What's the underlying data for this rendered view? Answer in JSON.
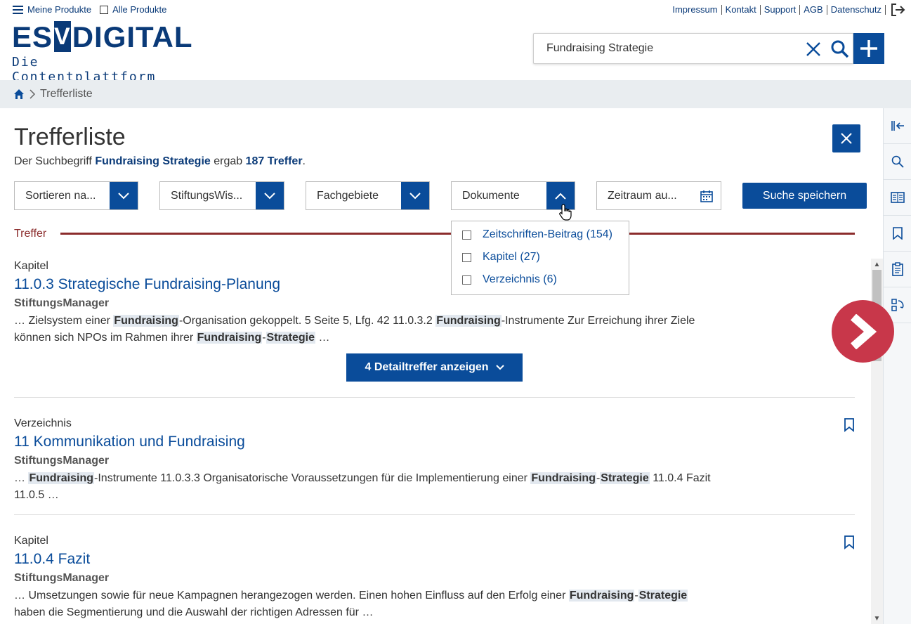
{
  "top_left": {
    "my_products": "Meine Produkte",
    "all_products": "Alle Produkte"
  },
  "top_right": {
    "links": [
      "Impressum",
      "Kontakt",
      "Support",
      "AGB",
      "Datenschutz"
    ]
  },
  "logo": {
    "esv_left": "ES",
    "esv_v": "V",
    "digital": "DIGITAL",
    "subtitle": "Die Contentplattform"
  },
  "search": {
    "value": "Fundraising Strategie"
  },
  "breadcrumb": {
    "current": "Trefferliste"
  },
  "page": {
    "title": "Trefferliste",
    "summary_prefix": "Der Suchbegriff ",
    "summary_term": "Fundraising Strategie",
    "summary_middle": " ergab ",
    "summary_count": "187 Treffer",
    "summary_suffix": "."
  },
  "filters": {
    "sort": "Sortieren na...",
    "product": "StiftungsWis...",
    "subject": "Fachgebiete",
    "documents": "Dokumente",
    "period": "Zeitraum au...",
    "save_search": "Suche speichern"
  },
  "documents_dropdown": {
    "options": [
      "Zeitschriften-Beitrag (154)",
      "Kapitel (27)",
      "Verzeichnis (6)"
    ]
  },
  "section": {
    "label": "Treffer"
  },
  "results": [
    {
      "type": "Kapitel",
      "title": "11.0.3 Strategische Fundraising-Planung",
      "source": "StiftungsManager",
      "snippet_a1": "… Zielsystem einer ",
      "snippet_h1": "Fundraising",
      "snippet_a2": "-Organisation gekoppelt. 5 Seite 5, Lfg. 42 11.0.3.2 ",
      "snippet_h2": "Fundraising",
      "snippet_a3": "-Instrumente Zur Erreichung ihrer Ziele können sich NPOs im Rahmen ihrer ",
      "snippet_h3": "Fundraising",
      "snippet_a4": "-",
      "snippet_h4": "Strategie",
      "snippet_a5": " …",
      "detail_button": "4 Detailtreffer anzeigen"
    },
    {
      "type": "Verzeichnis",
      "title": "11 Kommunikation und Fundraising",
      "source": "StiftungsManager",
      "snippet_a1": "… ",
      "snippet_h1": "Fundraising",
      "snippet_a2": "-Instrumente 11.0.3.3 Organisatorische Voraussetzungen für die Implementierung einer ",
      "snippet_h2": "Fundraising",
      "snippet_a3": "-",
      "snippet_h3": "Strategie",
      "snippet_a4": " 11.0.4 Fazit 11.0.5 …"
    },
    {
      "type": "Kapitel",
      "title": "11.0.4 Fazit",
      "source": "StiftungsManager",
      "snippet_a1": "… Umsetzungen sowie für neue Kampagnen herangezogen werden. Einen hohen Einfluss auf den Erfolg einer ",
      "snippet_h1": "Fundraising",
      "snippet_a2": "-",
      "snippet_h2": "Strategie",
      "snippet_a3": " haben die Segmentierung und die Auswahl der richtigen Adressen für …"
    }
  ],
  "colors": {
    "primary": "#0a4c9a",
    "dark_blue": "#0a3a78",
    "treffer_red": "#8b2c2c",
    "circle_red": "#c8374a"
  }
}
